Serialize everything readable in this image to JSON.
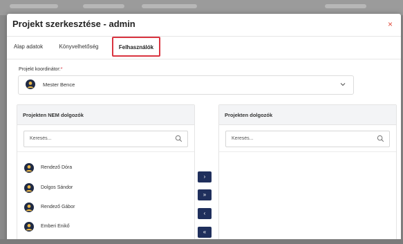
{
  "modal": {
    "title": "Projekt szerkesztése - admin",
    "close_label": "×"
  },
  "tabs": [
    {
      "label": "Alap adatok",
      "active": false
    },
    {
      "label": "Könyvelhetőség",
      "active": false
    },
    {
      "label": "Felhasználók",
      "active": true
    }
  ],
  "coordinator": {
    "label": "Projekt koordinátor:",
    "required_mark": "*",
    "selected": "Mester Bence"
  },
  "left_panel": {
    "title": "Projekten NEM dolgozók",
    "search_placeholder": "Keresés...",
    "users": [
      "Rendező Dóra",
      "Dolgos Sándor",
      "Rendező Gábor",
      "Emberi Enikő"
    ]
  },
  "right_panel": {
    "title": "Projekten dolgozók",
    "search_placeholder": "Keresés...",
    "users": []
  },
  "transfer_buttons": [
    {
      "label": "›",
      "name": "move-selected-right-button"
    },
    {
      "label": "»",
      "name": "move-all-right-button"
    },
    {
      "label": "‹",
      "name": "move-selected-left-button"
    },
    {
      "label": "«",
      "name": "move-all-left-button"
    }
  ],
  "colors": {
    "accent": "#1f2f5c",
    "active_tab_border": "#d9333f",
    "close": "#e04a3a",
    "avatar": "#1f2a44"
  }
}
